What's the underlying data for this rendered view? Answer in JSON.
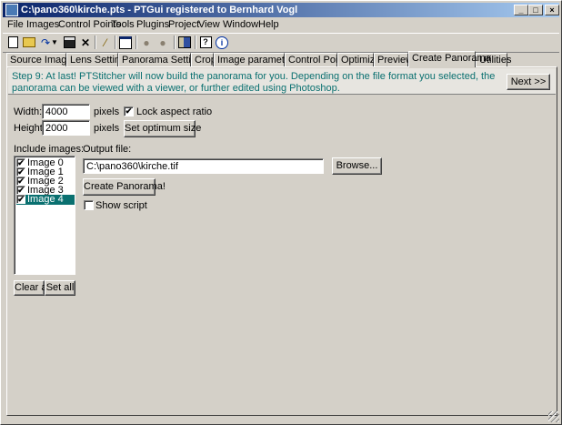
{
  "window": {
    "title": "C:\\pano360\\kirche.pts - PTGui registered to Bernhard Vogl"
  },
  "menu": [
    "File",
    "Images",
    "Control Points",
    "Tools",
    "Plugins",
    "Project",
    "View",
    "Window",
    "Help"
  ],
  "tabs": [
    "Source Images",
    "Lens Settings",
    "Panorama Settings",
    "Crop",
    "Image parameters",
    "Control Points",
    "Optimizer",
    "Preview",
    "Create Panorama",
    "Utilities"
  ],
  "active_tab": "Create Panorama",
  "step_text": "Step 9: At last! PTStitcher will now build the panorama for you. Depending on the file format you selected, the panorama can be viewed with a viewer, or further edited using Photoshop.",
  "next_label": "Next >>",
  "width_label": "Width:",
  "width_value": "4000",
  "height_label": "Height:",
  "height_value": "2000",
  "pixels_unit": "pixels",
  "lock_aspect_label": "Lock aspect ratio",
  "optimum_size_label": "Set optimum size",
  "include_images_label": "Include images:",
  "images": [
    {
      "name": "Image 0",
      "checked": true
    },
    {
      "name": "Image 1",
      "checked": true
    },
    {
      "name": "Image 2",
      "checked": true
    },
    {
      "name": "Image 3",
      "checked": true
    },
    {
      "name": "Image 4",
      "checked": true
    }
  ],
  "selected_image": "Image 4",
  "output_file_label": "Output file:",
  "output_file_value": "C:\\pano360\\kirche.tif",
  "browse_label": "Browse...",
  "create_label": "Create Panorama!",
  "show_script_label": "Show script",
  "clear_all_label": "Clear all",
  "set_all_label": "Set all",
  "check_mark": "✔",
  "caption_buttons": {
    "minimize": "_",
    "maximize": "□",
    "close": "×"
  },
  "toolbar_icons": [
    "new-icon",
    "open-icon",
    "redo-icon",
    "dropdown-icon",
    "save-icon",
    "delete-icon",
    "wand-icon",
    "settings-window-icon",
    "zoom-in-icon",
    "zoom-out-icon",
    "panel-icon",
    "help-icon",
    "info-icon"
  ]
}
